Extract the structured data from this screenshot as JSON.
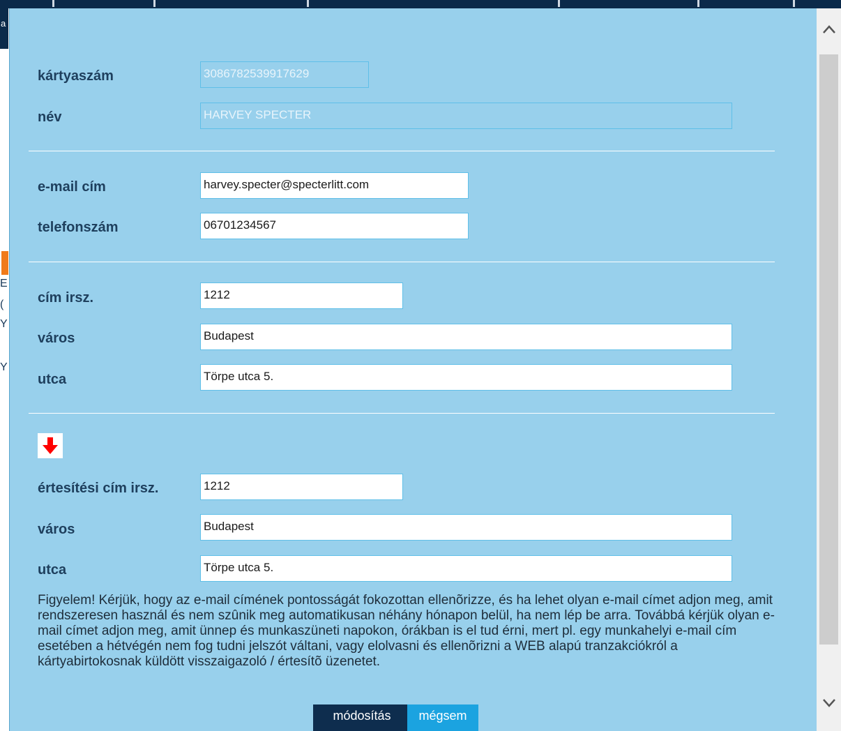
{
  "background": {
    "top_left_letter": "a",
    "left_fragments": [
      "E",
      "(",
      "Y",
      "Y"
    ]
  },
  "form": {
    "card_number": {
      "label": "kártyaszám",
      "value": "3086782539917629"
    },
    "name": {
      "label": "név",
      "value": "HARVEY SPECTER"
    },
    "email": {
      "label": "e-mail cím",
      "value": "harvey.specter@specterlitt.com"
    },
    "phone": {
      "label": "telefonszám",
      "value": "06701234567"
    },
    "address": {
      "zip": {
        "label": "cím irsz.",
        "value": "1212"
      },
      "city": {
        "label": "város",
        "value": "Budapest"
      },
      "street": {
        "label": "utca",
        "value": "Törpe utca 5."
      }
    },
    "notification_address": {
      "zip": {
        "label": "értesítési cím irsz.",
        "value": "1212"
      },
      "city": {
        "label": "város",
        "value": "Budapest"
      },
      "street": {
        "label": "utca",
        "value": "Törpe utca 5."
      }
    },
    "notice": "Figyelem! Kérjük, hogy az e-mail címének pontosságát fokozottan ellenõrizze, és ha lehet olyan e-mail címet adjon meg, amit rendszeresen használ és nem szûnik meg automatikusan néhány hónapon belül, ha nem lép be arra. Továbbá kérjük olyan e-mail címet adjon meg, amit ünnep és munkaszüneti napokon, órákban is el tud érni, mert pl. egy munkahelyi e-mail cím esetében a hétvégén nem fog tudni jelszót váltani, vagy elolvasni és ellenõrizni a WEB alapú tranzakciókról a kártyabirtokosnak küldött visszaigazoló / értesítõ üzenetet.",
    "buttons": {
      "submit": "módosítás",
      "cancel": "mégsem"
    }
  },
  "colors": {
    "modal_bg": "#98d0ec",
    "label_text": "#1e3f5d",
    "primary_button": "#0e2d4e",
    "secondary_button": "#1ba3e0",
    "arrow": "#ff0000"
  },
  "icons": {
    "copy_arrow": "arrow-down-icon",
    "scroll_up": "chevron-up-icon",
    "scroll_down": "chevron-down-icon"
  }
}
